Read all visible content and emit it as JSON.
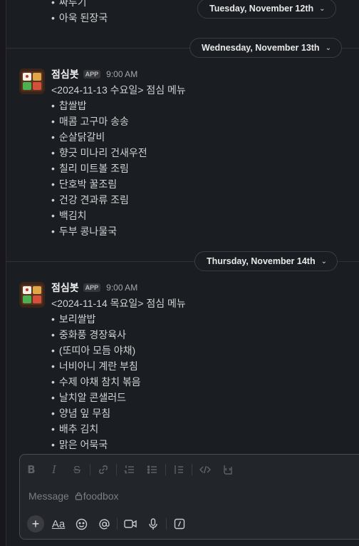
{
  "feed": {
    "prev_tail": [
      "짜투기",
      "아욱 된장국"
    ],
    "days": [
      {
        "label": "Tuesday, November 12th"
      },
      {
        "label": "Wednesday, November 13th"
      },
      {
        "label": "Thursday, November 14th"
      }
    ],
    "messages": [
      {
        "sender": "점심봇",
        "badge": "APP",
        "time": "9:00 AM",
        "title": "<2024-11-13 수요일> 점심 메뉴",
        "items": [
          "찹쌀밥",
          "매콤 고구마 송송",
          "순살닭갈비",
          "향긋 미나리 건새우전",
          "칠리 미트볼 조림",
          "단호박 꿀조림",
          "건강 견과류 조림",
          "백김치",
          "두부 콩나물국"
        ]
      },
      {
        "sender": "점심봇",
        "badge": "APP",
        "time": "9:00 AM",
        "title": "<2024-11-14 목요일> 점심 메뉴",
        "items": [
          "보리쌀밥",
          "중화풍 경장육사",
          "(또띠아 모듬 야채)",
          "너비아니 계란 부침",
          "수제 야채 참치 볶음",
          "날치알 콘샐러드",
          "양념 잎 무침",
          "배추 김치",
          "맑은 어묵국"
        ]
      }
    ]
  },
  "composer": {
    "placeholder_prefix": "Message",
    "channel": "foodbox",
    "format_icons": [
      "bold-icon",
      "italic-icon",
      "strikethrough-icon",
      "link-icon",
      "ordered-list-icon",
      "bulleted-list-icon",
      "blockquote-icon",
      "code-icon",
      "code-block-icon"
    ],
    "bottom_icons": [
      "plus-icon",
      "text-format-icon",
      "emoji-icon",
      "mention-icon",
      "video-icon",
      "microphone-icon",
      "slash-command-icon"
    ]
  }
}
